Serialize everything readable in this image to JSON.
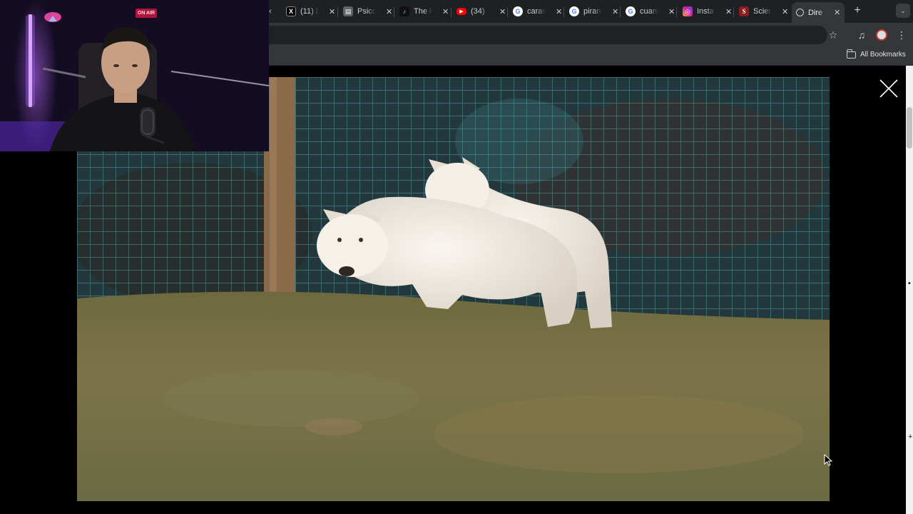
{
  "browser": {
    "tabs": [
      {
        "label": "(11) D",
        "icon": "x-logo-icon",
        "color": "#000000"
      },
      {
        "label": "Psico",
        "icon": "page-icon",
        "color": "#5f6368"
      },
      {
        "label": "The l",
        "icon": "tiktok-icon",
        "color": "#111111"
      },
      {
        "label": "(34)",
        "icon": "youtube-icon",
        "color": "#ff0000"
      },
      {
        "label": "caras",
        "icon": "google-icon",
        "color": "#4285f4"
      },
      {
        "label": "piran",
        "icon": "google-icon",
        "color": "#4285f4"
      },
      {
        "label": "cuant",
        "icon": "google-icon",
        "color": "#4285f4"
      },
      {
        "label": "Insta",
        "icon": "instagram-icon",
        "color": "#d6249f"
      },
      {
        "label": "Scien",
        "icon": "science-icon",
        "color": "#8a1c1c"
      },
      {
        "label": "Dire",
        "icon": "globe-icon",
        "color": "#5f6368",
        "active": true
      }
    ],
    "new_tab_glyph": "+",
    "bookmarks_all_label": "All Bookmarks"
  },
  "lightbox": {
    "image_subject": "two white wolves standing on grass in front of a wire fence",
    "close_glyph": "×"
  },
  "webcam": {
    "onair_label": "ON AIR"
  },
  "colors": {
    "tabstrip_bg": "#1f2023",
    "toolbar_bg": "#35363a",
    "lightbox_bg": "#000000",
    "accent_neon": "#a24dff"
  }
}
